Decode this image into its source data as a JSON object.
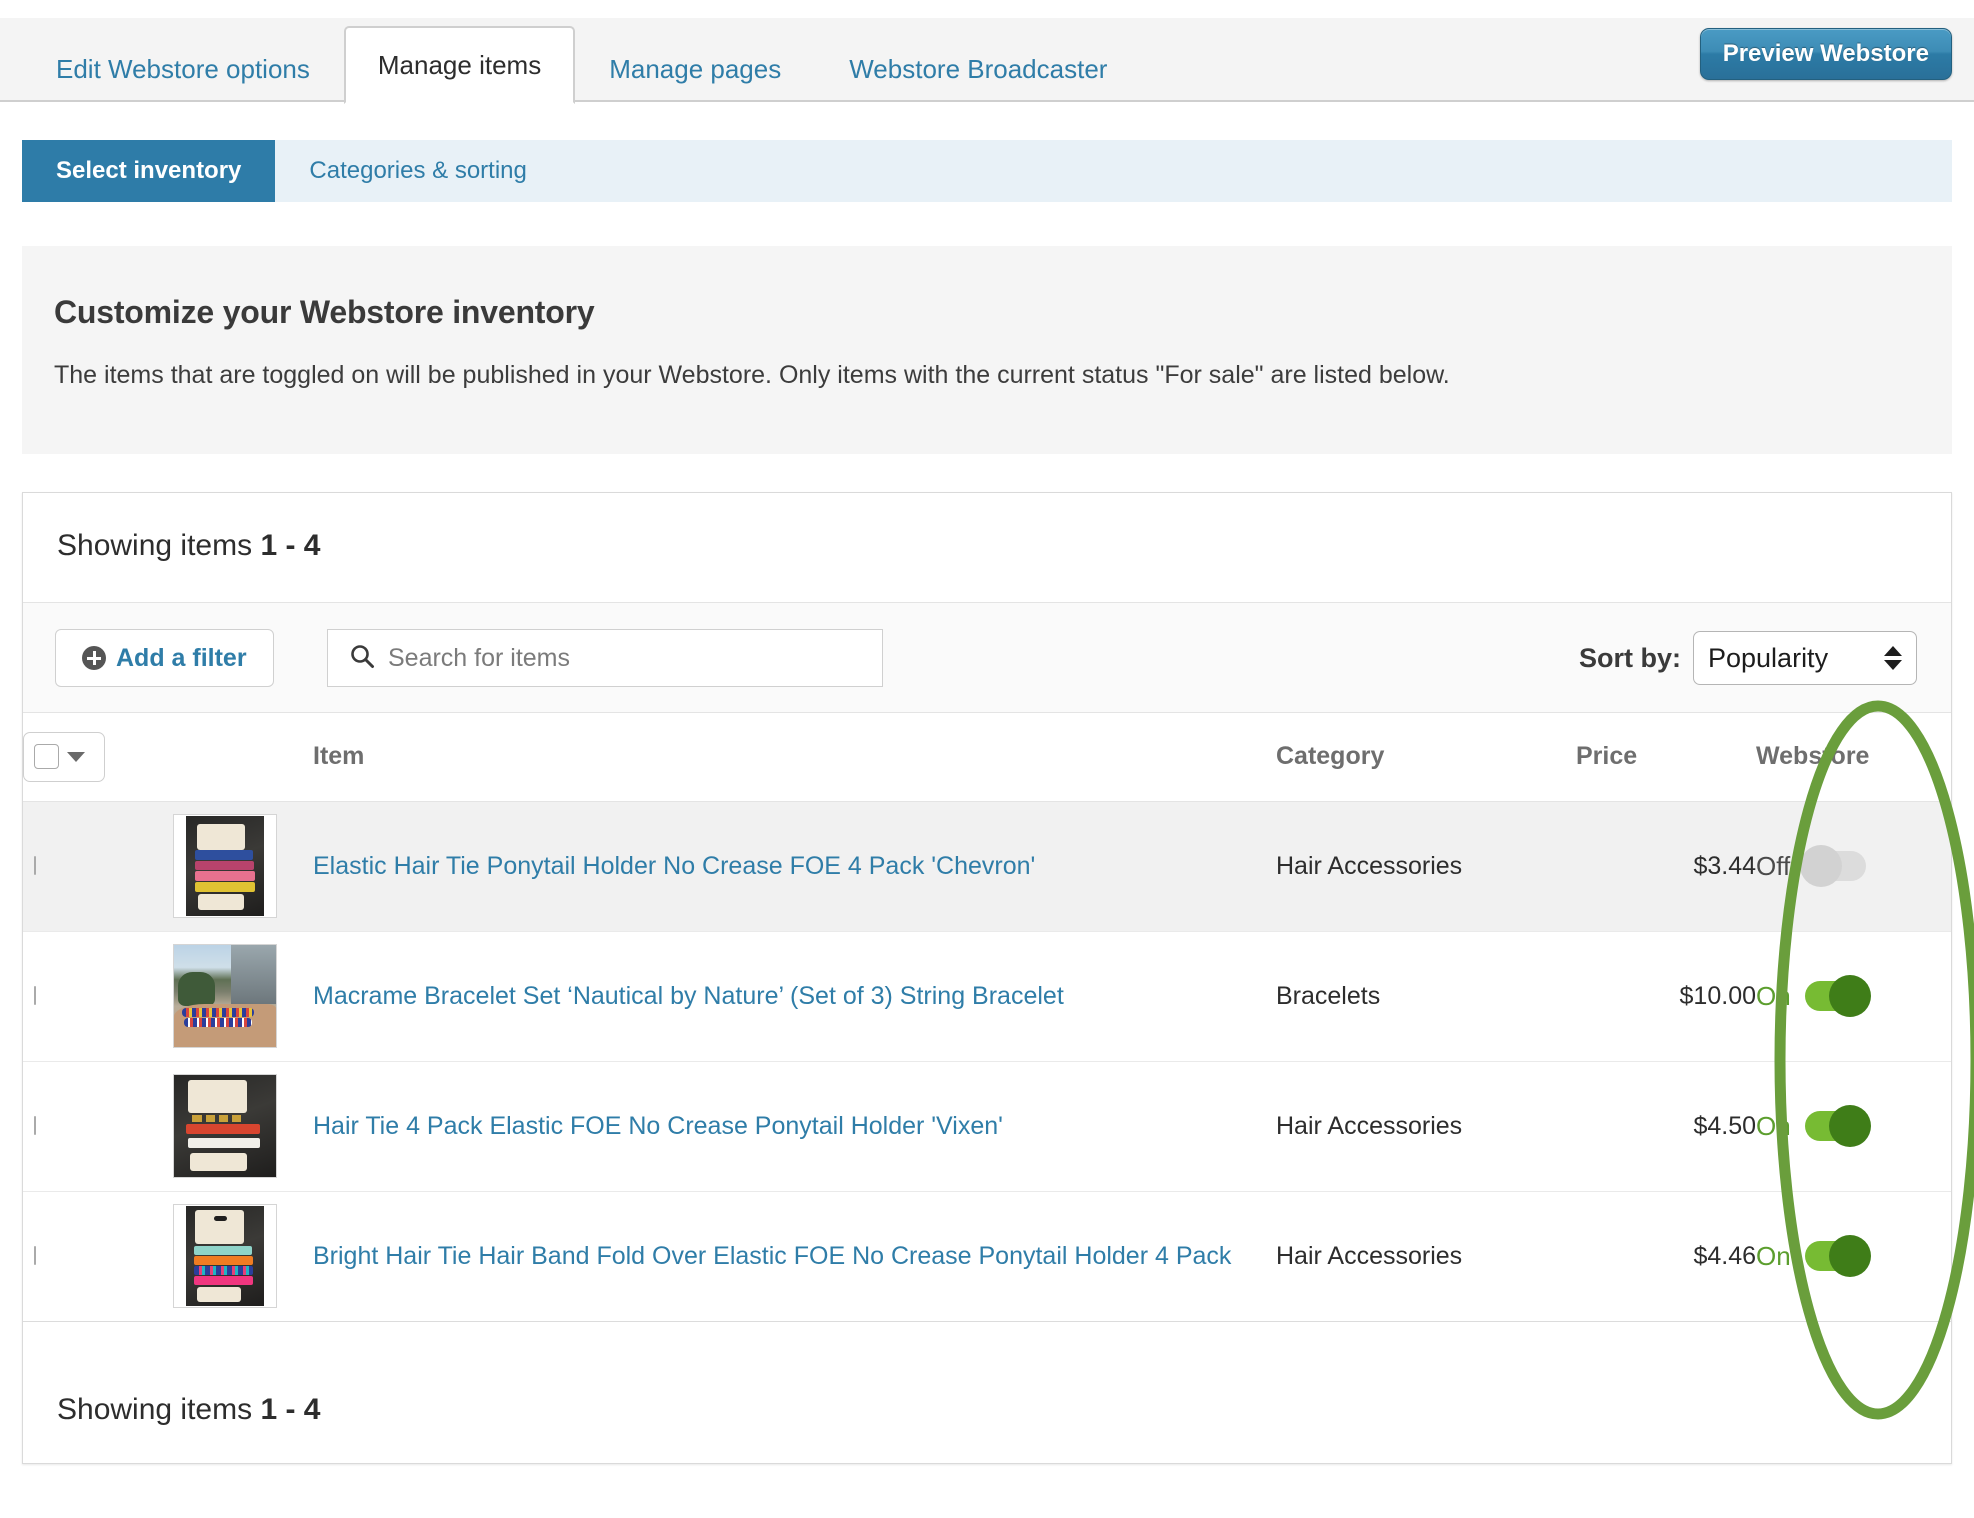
{
  "top_nav": {
    "tabs": [
      {
        "label": "Edit Webstore options",
        "active": false
      },
      {
        "label": "Manage items",
        "active": true
      },
      {
        "label": "Manage pages",
        "active": false
      },
      {
        "label": "Webstore Broadcaster",
        "active": false
      }
    ],
    "preview_button": "Preview Webstore"
  },
  "sub_nav": {
    "tabs": [
      {
        "label": "Select inventory",
        "active": true
      },
      {
        "label": "Categories & sorting",
        "active": false
      }
    ]
  },
  "info_panel": {
    "heading": "Customize your Webstore inventory",
    "body": "The items that are toggled on will be published in your Webstore. Only items with the current status \"For sale\" are listed below."
  },
  "listing": {
    "showing_prefix": "Showing items",
    "showing_range": "1 - 4",
    "filter_button": "Add a filter",
    "search_placeholder": "Search for items",
    "search_value": "",
    "sort_label": "Sort by:",
    "sort_value": "Popularity",
    "sort_options": [
      "Popularity"
    ],
    "columns": {
      "item": "Item",
      "category": "Category",
      "price": "Price",
      "webstore": "Webstore"
    },
    "rows": [
      {
        "title": "Elastic Hair Tie Ponytail Holder No Crease FOE 4 Pack 'Chevron'",
        "category": "Hair Accessories",
        "price": "$3.44",
        "webstore_state": "Off",
        "thumb": "hairtie-chevron"
      },
      {
        "title": "Macrame Bracelet Set ‘Nautical by Nature’ (Set of 3) String Bracelet",
        "category": "Bracelets",
        "price": "$10.00",
        "webstore_state": "On",
        "thumb": "macrame-wrist"
      },
      {
        "title": "Hair Tie 4 Pack Elastic FOE No Crease Ponytail Holder 'Vixen'",
        "category": "Hair Accessories",
        "price": "$4.50",
        "webstore_state": "On",
        "thumb": "hairtie-vixen"
      },
      {
        "title": "Bright Hair Tie Hair Band Fold Over Elastic FOE No Crease Ponytail Holder 4 Pack",
        "category": "Hair Accessories",
        "price": "$4.46",
        "webstore_state": "On",
        "thumb": "hairtie-bright"
      }
    ]
  },
  "footer": {
    "showing_prefix": "Showing items",
    "showing_range": "1 - 4"
  },
  "annotation": {
    "shape": "ellipse",
    "color": "#6a9e3c",
    "target": "Webstore toggle column"
  },
  "colors": {
    "link": "#2f7da8",
    "accent_blue": "#2e7ca8",
    "toggle_on": "#77bb33",
    "toggle_on_knob": "#3f7d18",
    "toggle_off": "#dcdcdc",
    "annotation_green": "#6a9e3c"
  }
}
